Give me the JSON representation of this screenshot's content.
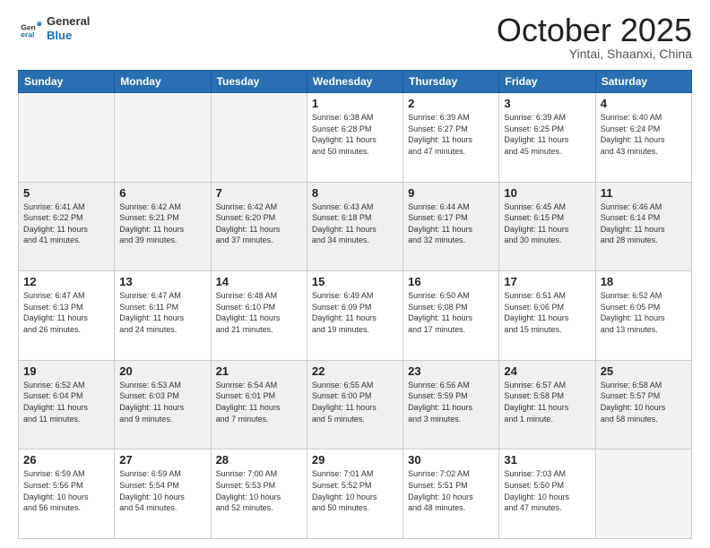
{
  "header": {
    "logo_general": "General",
    "logo_blue": "Blue",
    "month": "October 2025",
    "location": "Yintai, Shaanxi, China"
  },
  "days_of_week": [
    "Sunday",
    "Monday",
    "Tuesday",
    "Wednesday",
    "Thursday",
    "Friday",
    "Saturday"
  ],
  "weeks": [
    [
      {
        "day": "",
        "text": ""
      },
      {
        "day": "",
        "text": ""
      },
      {
        "day": "",
        "text": ""
      },
      {
        "day": "1",
        "text": "Sunrise: 6:38 AM\nSunset: 6:28 PM\nDaylight: 11 hours\nand 50 minutes."
      },
      {
        "day": "2",
        "text": "Sunrise: 6:39 AM\nSunset: 6:27 PM\nDaylight: 11 hours\nand 47 minutes."
      },
      {
        "day": "3",
        "text": "Sunrise: 6:39 AM\nSunset: 6:25 PM\nDaylight: 11 hours\nand 45 minutes."
      },
      {
        "day": "4",
        "text": "Sunrise: 6:40 AM\nSunset: 6:24 PM\nDaylight: 11 hours\nand 43 minutes."
      }
    ],
    [
      {
        "day": "5",
        "text": "Sunrise: 6:41 AM\nSunset: 6:22 PM\nDaylight: 11 hours\nand 41 minutes."
      },
      {
        "day": "6",
        "text": "Sunrise: 6:42 AM\nSunset: 6:21 PM\nDaylight: 11 hours\nand 39 minutes."
      },
      {
        "day": "7",
        "text": "Sunrise: 6:42 AM\nSunset: 6:20 PM\nDaylight: 11 hours\nand 37 minutes."
      },
      {
        "day": "8",
        "text": "Sunrise: 6:43 AM\nSunset: 6:18 PM\nDaylight: 11 hours\nand 34 minutes."
      },
      {
        "day": "9",
        "text": "Sunrise: 6:44 AM\nSunset: 6:17 PM\nDaylight: 11 hours\nand 32 minutes."
      },
      {
        "day": "10",
        "text": "Sunrise: 6:45 AM\nSunset: 6:15 PM\nDaylight: 11 hours\nand 30 minutes."
      },
      {
        "day": "11",
        "text": "Sunrise: 6:46 AM\nSunset: 6:14 PM\nDaylight: 11 hours\nand 28 minutes."
      }
    ],
    [
      {
        "day": "12",
        "text": "Sunrise: 6:47 AM\nSunset: 6:13 PM\nDaylight: 11 hours\nand 26 minutes."
      },
      {
        "day": "13",
        "text": "Sunrise: 6:47 AM\nSunset: 6:11 PM\nDaylight: 11 hours\nand 24 minutes."
      },
      {
        "day": "14",
        "text": "Sunrise: 6:48 AM\nSunset: 6:10 PM\nDaylight: 11 hours\nand 21 minutes."
      },
      {
        "day": "15",
        "text": "Sunrise: 6:49 AM\nSunset: 6:09 PM\nDaylight: 11 hours\nand 19 minutes."
      },
      {
        "day": "16",
        "text": "Sunrise: 6:50 AM\nSunset: 6:08 PM\nDaylight: 11 hours\nand 17 minutes."
      },
      {
        "day": "17",
        "text": "Sunrise: 6:51 AM\nSunset: 6:06 PM\nDaylight: 11 hours\nand 15 minutes."
      },
      {
        "day": "18",
        "text": "Sunrise: 6:52 AM\nSunset: 6:05 PM\nDaylight: 11 hours\nand 13 minutes."
      }
    ],
    [
      {
        "day": "19",
        "text": "Sunrise: 6:52 AM\nSunset: 6:04 PM\nDaylight: 11 hours\nand 11 minutes."
      },
      {
        "day": "20",
        "text": "Sunrise: 6:53 AM\nSunset: 6:03 PM\nDaylight: 11 hours\nand 9 minutes."
      },
      {
        "day": "21",
        "text": "Sunrise: 6:54 AM\nSunset: 6:01 PM\nDaylight: 11 hours\nand 7 minutes."
      },
      {
        "day": "22",
        "text": "Sunrise: 6:55 AM\nSunset: 6:00 PM\nDaylight: 11 hours\nand 5 minutes."
      },
      {
        "day": "23",
        "text": "Sunrise: 6:56 AM\nSunset: 5:59 PM\nDaylight: 11 hours\nand 3 minutes."
      },
      {
        "day": "24",
        "text": "Sunrise: 6:57 AM\nSunset: 5:58 PM\nDaylight: 11 hours\nand 1 minute."
      },
      {
        "day": "25",
        "text": "Sunrise: 6:58 AM\nSunset: 5:57 PM\nDaylight: 10 hours\nand 58 minutes."
      }
    ],
    [
      {
        "day": "26",
        "text": "Sunrise: 6:59 AM\nSunset: 5:56 PM\nDaylight: 10 hours\nand 56 minutes."
      },
      {
        "day": "27",
        "text": "Sunrise: 6:59 AM\nSunset: 5:54 PM\nDaylight: 10 hours\nand 54 minutes."
      },
      {
        "day": "28",
        "text": "Sunrise: 7:00 AM\nSunset: 5:53 PM\nDaylight: 10 hours\nand 52 minutes."
      },
      {
        "day": "29",
        "text": "Sunrise: 7:01 AM\nSunset: 5:52 PM\nDaylight: 10 hours\nand 50 minutes."
      },
      {
        "day": "30",
        "text": "Sunrise: 7:02 AM\nSunset: 5:51 PM\nDaylight: 10 hours\nand 48 minutes."
      },
      {
        "day": "31",
        "text": "Sunrise: 7:03 AM\nSunset: 5:50 PM\nDaylight: 10 hours\nand 47 minutes."
      },
      {
        "day": "",
        "text": ""
      }
    ]
  ]
}
